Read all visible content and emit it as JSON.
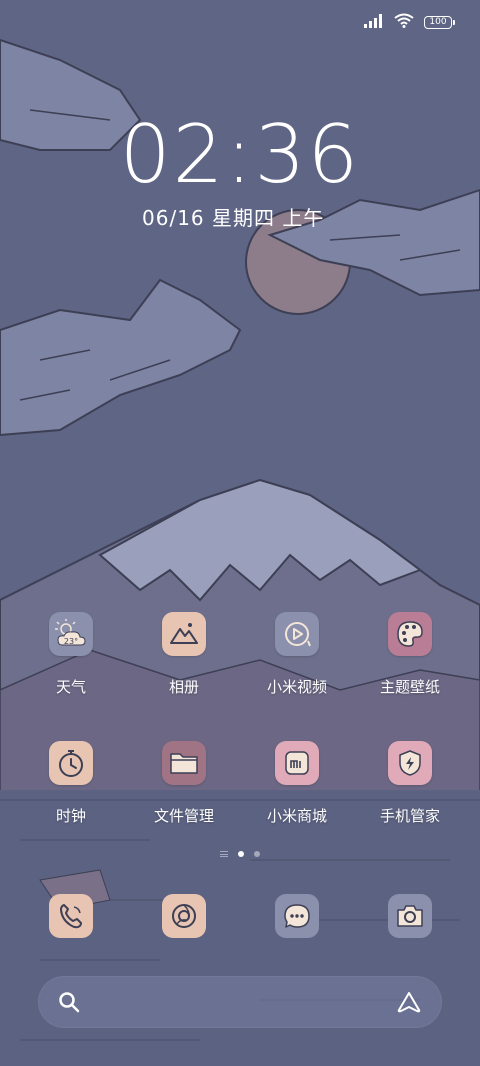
{
  "status": {
    "battery": "100"
  },
  "lockclock": {
    "time": "02:36",
    "date": "06/16 星期四 上午"
  },
  "weather": {
    "temp": "23°"
  },
  "apps_row1": [
    {
      "label": "天气",
      "icon": "weather-icon",
      "color": "#8b90ad"
    },
    {
      "label": "相册",
      "icon": "gallery-icon",
      "color": "#e8c5b2"
    },
    {
      "label": "小米视频",
      "icon": "video-icon",
      "color": "#8b90ad"
    },
    {
      "label": "主题壁纸",
      "icon": "themes-icon",
      "color": "#b97e95"
    }
  ],
  "apps_row2": [
    {
      "label": "时钟",
      "icon": "clock-icon",
      "color": "#e8c5b2"
    },
    {
      "label": "文件管理",
      "icon": "folder-icon",
      "color": "#a07484"
    },
    {
      "label": "小米商城",
      "icon": "mi-store-icon",
      "color": "#e1aab9"
    },
    {
      "label": "手机管家",
      "icon": "security-icon",
      "color": "#e1aab9"
    }
  ],
  "dock": [
    {
      "name": "phone",
      "icon": "phone-icon",
      "color": "#e8c5b2"
    },
    {
      "name": "browser",
      "icon": "browser-icon",
      "color": "#e8c5b2"
    },
    {
      "name": "messages",
      "icon": "messages-icon",
      "color": "#8b90ad"
    },
    {
      "name": "camera",
      "icon": "camera-icon",
      "color": "#8b90ad"
    }
  ]
}
